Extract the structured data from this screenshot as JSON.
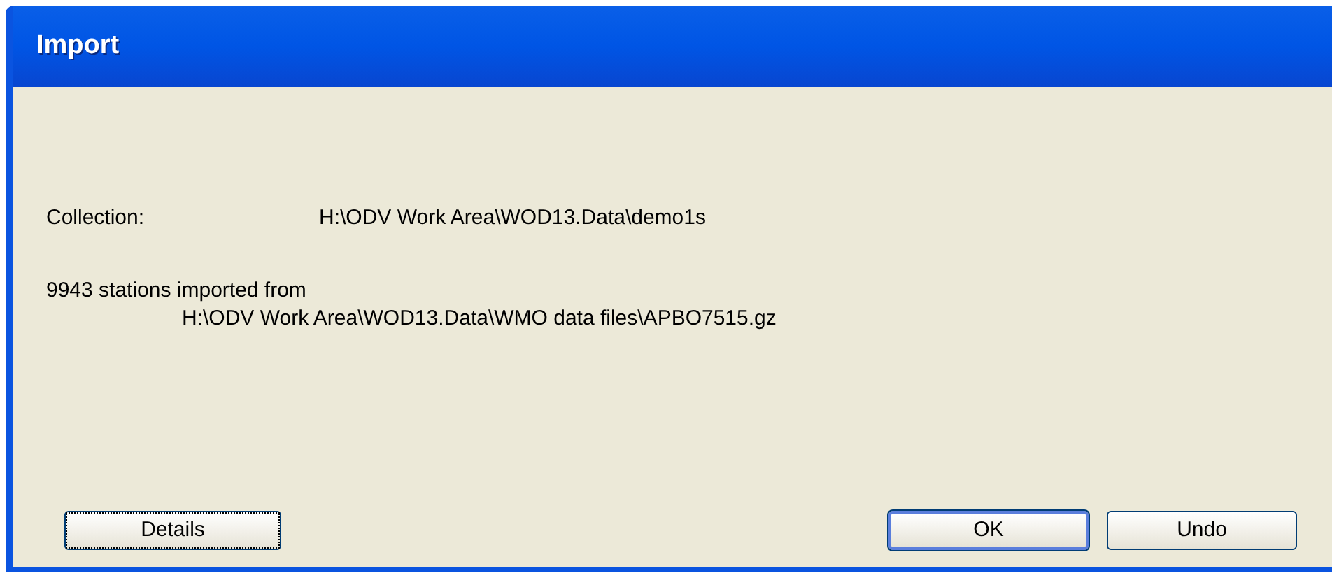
{
  "window": {
    "title": "Import"
  },
  "collection": {
    "label": "Collection:",
    "path": "H:\\ODV Work Area\\WOD13.Data\\demo1s"
  },
  "message": {
    "summary": "9943 stations imported from",
    "source": "H:\\ODV Work Area\\WOD13.Data\\WMO data files\\APBO7515.gz"
  },
  "buttons": [
    {
      "label": "Details",
      "focused": true,
      "default": false
    },
    {
      "label": "OK",
      "focused": false,
      "default": true
    },
    {
      "label": "Undo",
      "focused": false,
      "default": false
    }
  ]
}
